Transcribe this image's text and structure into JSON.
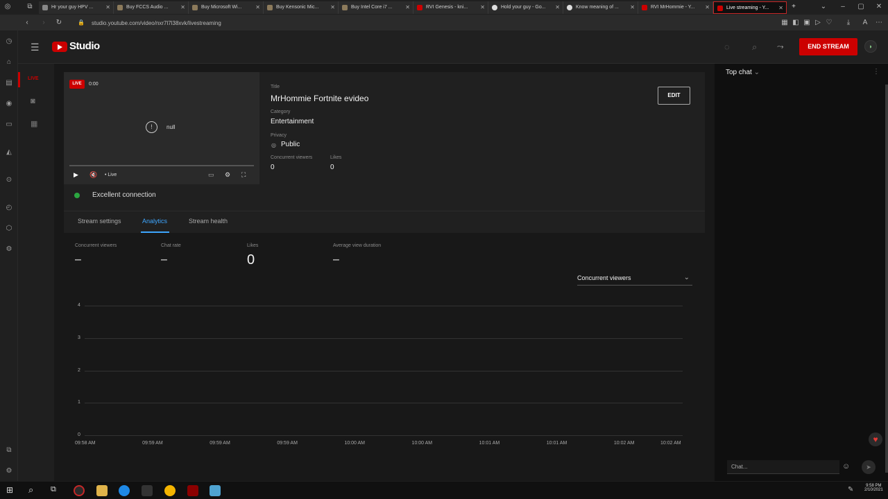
{
  "browser": {
    "tabs": [
      {
        "label": "Hr your guy HPV ..."
      },
      {
        "label": "Buy FCCS Audio ..."
      },
      {
        "label": "Buy Microsoft Wi..."
      },
      {
        "label": "Buy Kensonic Mic..."
      },
      {
        "label": "Buy Intel Core i7 ..."
      },
      {
        "label": "RVI Genesis - kni..."
      },
      {
        "label": "Hold your guy - Go..."
      },
      {
        "label": "Know meaning of ..."
      },
      {
        "label": "RVI MrHommie - Y..."
      },
      {
        "label": "Live streaming - Y..."
      }
    ],
    "url": "studio.youtube.com/video/nxr7l7l38xvk/livestreaming"
  },
  "studio": {
    "logo_text": "Studio",
    "end_stream_label": "END STREAM",
    "nav": {
      "live_label": "LIVE"
    }
  },
  "preview": {
    "live_badge": "LIVE",
    "time": "0:00",
    "offline_text": "null",
    "live_label": "• Live",
    "connection": "Excellent connection"
  },
  "stream_info": {
    "title_label": "Title",
    "title": "MrHommie Fortnite evideo",
    "category_label": "Category",
    "category": "Entertainment",
    "privacy_label": "Privacy",
    "privacy": "Public",
    "concurrent_label": "Concurrent viewers",
    "concurrent_value": "0",
    "likes_label": "Likes",
    "likes_value": "0",
    "edit_label": "EDIT"
  },
  "tabs": [
    {
      "label": "Stream settings"
    },
    {
      "label": "Analytics"
    },
    {
      "label": "Stream health"
    }
  ],
  "metrics": [
    {
      "label": "Concurrent viewers",
      "value": "–"
    },
    {
      "label": "Chat rate",
      "value": "–"
    },
    {
      "label": "Likes",
      "value": "0"
    },
    {
      "label": "Average view duration",
      "value": "–"
    }
  ],
  "chart_selector": "Concurrent viewers",
  "chart_data": {
    "type": "line",
    "title": "",
    "xlabel": "",
    "ylabel": "",
    "y_ticks": [
      "4",
      "3",
      "2",
      "1",
      "0"
    ],
    "x_ticks": [
      "09:58 AM",
      "09:59 AM",
      "09:59 AM",
      "09:59 AM",
      "10:00 AM",
      "10:00 AM",
      "10:01 AM",
      "10:01 AM",
      "10:02 AM",
      "10:02 AM"
    ],
    "ylim": [
      0,
      4
    ],
    "grid": true,
    "series": []
  },
  "chat": {
    "header": "Top chat",
    "placeholder": "Chat..."
  },
  "taskbar": {
    "time": "9:58 PM",
    "date": "2/10/2021"
  },
  "colors": {
    "accent_red": "#cc0000",
    "tab_blue": "#3ea6ff",
    "status_green": "#2ba640"
  }
}
